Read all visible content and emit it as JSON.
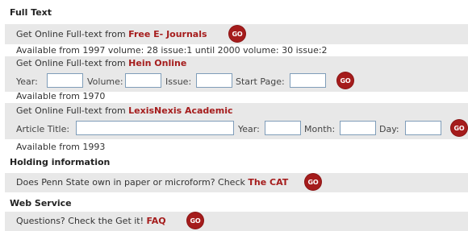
{
  "full_text": {
    "heading": "Full Text",
    "free_ejournals": {
      "prefix": "Get Online Full-text from ",
      "link": "Free E- Journals",
      "go": "GO",
      "availability": "Available from 1997 volume: 28 issue:1 until 2000 volume: 30 issue:2"
    },
    "hein_online": {
      "prefix": "Get Online Full-text from ",
      "link": "Hein Online",
      "year_label": "Year:",
      "volume_label": "Volume:",
      "issue_label": "Issue:",
      "start_page_label": "Start Page:",
      "year_value": "",
      "volume_value": "",
      "issue_value": "",
      "start_page_value": "",
      "go": "GO",
      "availability": "Available from 1970"
    },
    "lexisnexis": {
      "prefix": "Get Online Full-text from ",
      "link": "LexisNexis Academic",
      "article_title_label": "Article Title:",
      "year_label": "Year:",
      "month_label": "Month:",
      "day_label": "Day:",
      "article_title_value": "",
      "year_value": "",
      "month_value": "",
      "day_value": "",
      "go": "GO",
      "availability": "Available from 1993"
    }
  },
  "holding": {
    "heading": "Holding information",
    "prefix": "Does Penn State own in paper or microform? Check ",
    "link": "The CAT",
    "go": "GO"
  },
  "web_service": {
    "heading": "Web Service",
    "prefix": "Questions? Check the Get it! ",
    "link": "FAQ",
    "go": "GO"
  },
  "colors": {
    "accent": "#a51c1c",
    "band": "#e8e8e8"
  }
}
